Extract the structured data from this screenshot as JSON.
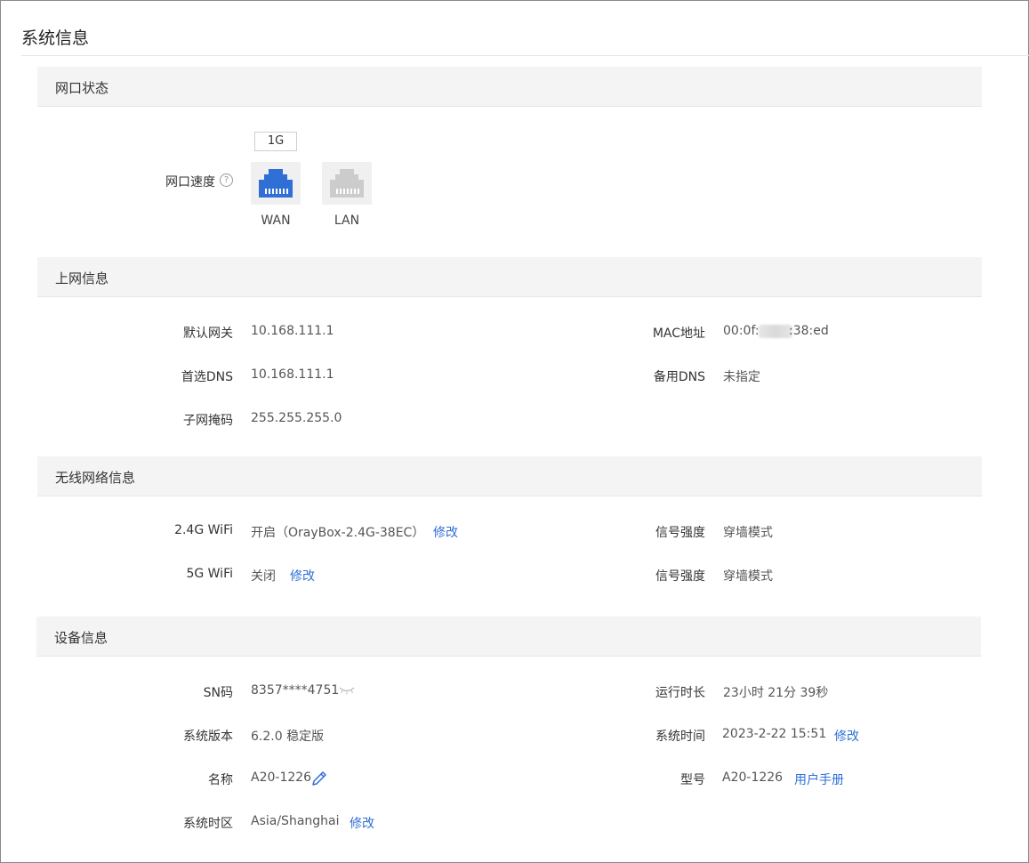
{
  "page_title": "系统信息",
  "sections": {
    "port_status": "网口状态",
    "internet": "上网信息",
    "wireless": "无线网络信息",
    "device": "设备信息"
  },
  "port": {
    "speed_label": "网口速度",
    "help_glyph": "?",
    "speed_badge": "1G",
    "wan_label": "WAN",
    "lan_label": "LAN",
    "wan_color": "#2f6fd6",
    "lan_color": "#cccccc"
  },
  "internet": {
    "gateway_label": "默认网关",
    "gateway_value": "10.168.111.1",
    "dns1_label": "首选DNS",
    "dns1_value": "10.168.111.1",
    "mask_label": "子网掩码",
    "mask_value": "255.255.255.0",
    "mac_label": "MAC地址",
    "mac_prefix": "00:0f:",
    "mac_suffix": ":38:ed",
    "dns2_label": "备用DNS",
    "dns2_value": "未指定"
  },
  "wireless": {
    "wifi24_label": "2.4G WiFi",
    "wifi24_value": "开启（OrayBox-2.4G-38EC）",
    "wifi24_edit": "修改",
    "wifi5_label": "5G WiFi",
    "wifi5_value": "关闭",
    "wifi5_edit": "修改",
    "signal1_label": "信号强度",
    "signal1_value": "穿墙模式",
    "signal2_label": "信号强度",
    "signal2_value": "穿墙模式"
  },
  "device": {
    "sn_label": "SN码",
    "sn_value": "8357****4751",
    "version_label": "系统版本",
    "version_value": "6.2.0 稳定版",
    "name_label": "名称",
    "name_value": "A20-1226",
    "tz_label": "系统时区",
    "tz_value": "Asia/Shanghai",
    "tz_edit": "修改",
    "uptime_label": "运行时长",
    "uptime_value": "23小时 21分 39秒",
    "systime_label": "系统时间",
    "systime_value": "2023-2-22 15:51",
    "systime_edit": "修改",
    "model_label": "型号",
    "model_value": "A20-1226",
    "manual_link": "用户手册"
  },
  "icons": {
    "help": "question-circle-icon",
    "ethernet": "ethernet-port-icon",
    "eye": "eye-closed-icon",
    "edit": "pencil-icon"
  },
  "accent_color": "#2f6fd6"
}
